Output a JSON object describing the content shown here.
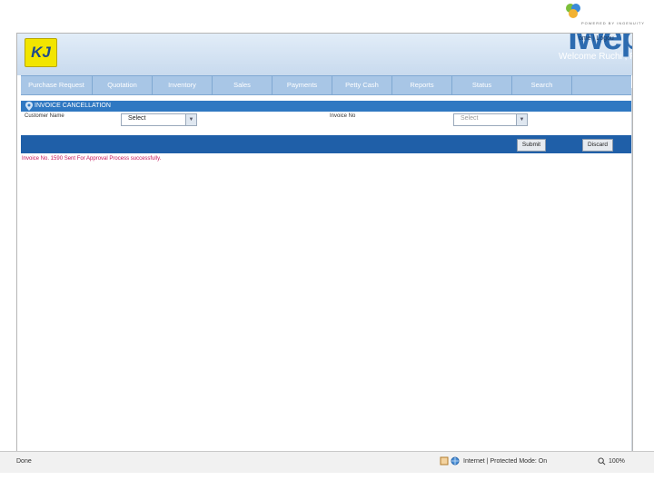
{
  "header": {
    "logo_text": "KJ",
    "brand_text": "iwep",
    "brand_tagline": "POWERED BY INGENUITY",
    "top_links": "ome | Logou",
    "welcome": "Welcome  Ruchi , Pune"
  },
  "nav": {
    "items": [
      "Purchase Request",
      "Quotation",
      "Inventory",
      "Sales",
      "Payments",
      "Petty Cash",
      "Reports",
      "Status",
      "Search"
    ]
  },
  "section": {
    "title": "INVOICE CANCELLATION"
  },
  "form": {
    "customer_label": "Customer Name",
    "customer_value": "Select",
    "invoice_label": "Invoice No",
    "invoice_value": "Select"
  },
  "actions": {
    "submit": "Submit",
    "discard": "Discard"
  },
  "message": "Invoice No. 1590 Sent For Approval Process successfully.",
  "statusbar": {
    "done": "Done",
    "zone": "Internet | Protected Mode: On",
    "zoom": "100%"
  },
  "colors": {
    "nav_bg": "#a8c6e6",
    "section_bar": "#2f78c2",
    "action_bar": "#1f5fa8",
    "message": "#c4145a",
    "logo_yellow": "#f2e500"
  }
}
